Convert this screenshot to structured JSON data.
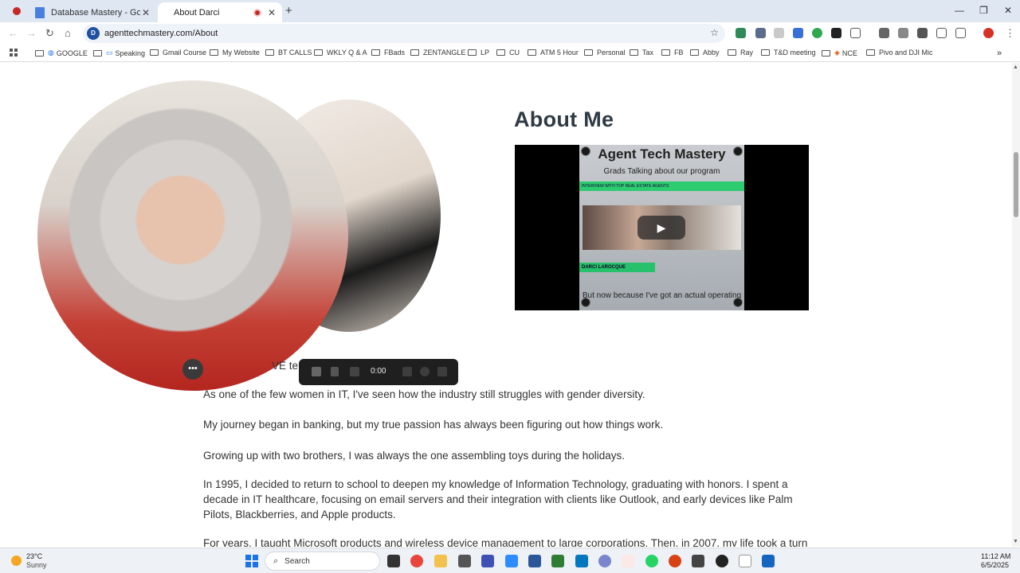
{
  "browser": {
    "tabs": [
      {
        "title": "Database Mastery - Google Do",
        "close": "✕"
      },
      {
        "title": "About Darci",
        "close": "✕"
      }
    ],
    "new_tab": "+",
    "window_controls": {
      "minimize": "—",
      "maximize": "❐",
      "close": "✕"
    },
    "url": "agenttechmastery.com/About",
    "site_icon_text": "D"
  },
  "bookmarks": [
    "GOOGLE",
    "Speaking",
    "Gmail Course",
    "My Website",
    "BT CALLS",
    "WKLY Q & A",
    "FBads",
    "ZENTANGLE",
    "LP",
    "CU",
    "ATM 5 Hour",
    "Personal",
    "Tax",
    "FB",
    "Abby",
    "Ray",
    "T&D meeting",
    "NCE",
    "Pivo and DJI Mic"
  ],
  "page": {
    "heading": "About Me",
    "video": {
      "title": "Agent Tech Mastery",
      "subtitle": "Grads Talking about our program",
      "band_text": "INTERVIEW WITH TOP REAL ESTATE AGENTS",
      "name_band": "DARCI LAROCQUE",
      "footer": "But now because I've got an actual operating"
    },
    "paragraphs": [
      "VE te                                                  ers dread are what I thrive on.",
      "As one of the few women in IT, I've seen how the industry still struggles with gender diversity.",
      "My journey began in banking, but my true passion has always been figuring out how things work.",
      "Growing up with two brothers, I was always the one assembling toys during the holidays.",
      "In 1995, I decided to return to school to deepen my knowledge of Information Technology, graduating with honors. I spent a decade in IT healthcare, focusing on email servers and their integration with clients like Outlook, and early devices like Palm Pilots, Blackberries, and Apple products.",
      "For years, I taught Microsoft products and wireless device management to large corporations. Then, in 2007, my life took a turn"
    ],
    "recorder": {
      "time": "0:00"
    },
    "camera_menu": "•••"
  },
  "taskbar": {
    "temperature": "23°C",
    "condition": "Sunny",
    "search_placeholder": "Search",
    "time": "11:12 AM",
    "date": "6/5/2025"
  }
}
